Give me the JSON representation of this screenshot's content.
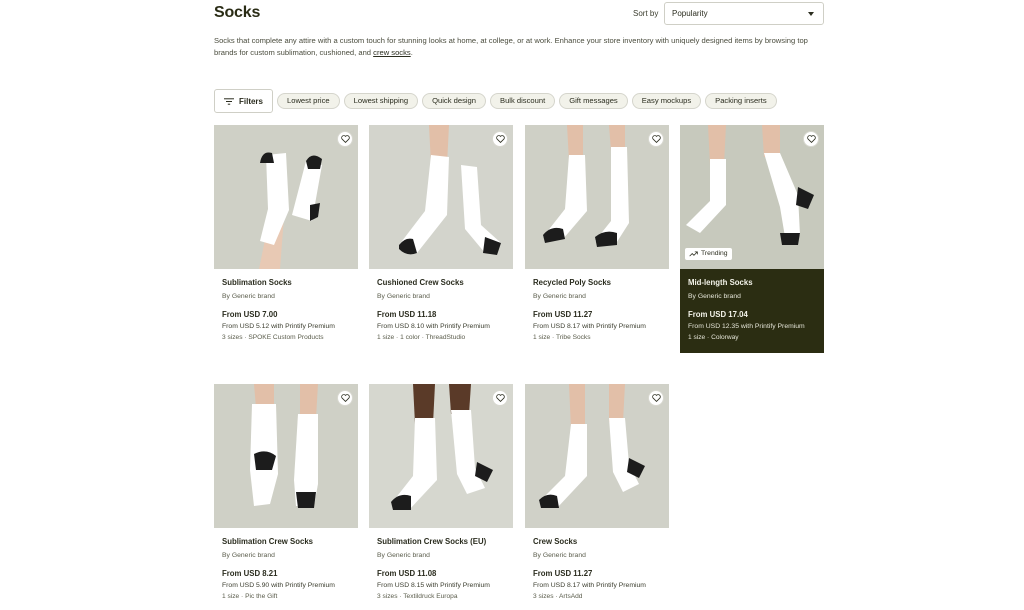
{
  "header": {
    "title": "Socks",
    "sort_label": "Sort by",
    "sort_value": "Popularity"
  },
  "description": {
    "text": "Socks that complete any attire with a custom touch for stunning looks at home, at college, or at work. Enhance your store inventory with uniquely designed items by browsing top brands for custom sublimation, cushioned, and ",
    "link": "crew socks",
    "end": "."
  },
  "filters": {
    "button_label": "Filters",
    "chips": [
      "Lowest price",
      "Lowest shipping",
      "Quick design",
      "Bulk discount",
      "Gift messages",
      "Easy mockups",
      "Packing inserts"
    ]
  },
  "products": [
    {
      "name": "Sublimation Socks",
      "brand": "By Generic brand",
      "price": "From USD 7.00",
      "premium": "From USD 5.12 with Printify Premium",
      "meta": "3 sizes · SPOKE Custom Products"
    },
    {
      "name": "Cushioned Crew Socks",
      "brand": "By Generic brand",
      "price": "From USD 11.18",
      "premium": "From USD 8.10 with Printify Premium",
      "meta": "1 size · 1 color · ThreadStudio"
    },
    {
      "name": "Recycled Poly Socks",
      "brand": "By Generic brand",
      "price": "From USD 11.27",
      "premium": "From USD 8.17 with Printify Premium",
      "meta": "1 size · Tribe Socks"
    },
    {
      "name": "Mid-length Socks",
      "brand": "By Generic brand",
      "price": "From USD 17.04",
      "premium": "From USD 12.35 with Printify Premium",
      "meta": "1 size · Colorway",
      "badge": "Trending"
    },
    {
      "name": "Sublimation Crew Socks",
      "brand": "By Generic brand",
      "price": "From USD 8.21",
      "premium": "From USD 5.90 with Printify Premium",
      "meta": "1 size · Pic the Gift"
    },
    {
      "name": "Sublimation Crew Socks (EU)",
      "brand": "By Generic brand",
      "price": "From USD 11.08",
      "premium": "From USD 8.15 with Printify Premium",
      "meta": "3 sizes · Textildruck Europa"
    },
    {
      "name": "Crew Socks",
      "brand": "By Generic brand",
      "price": "From USD 11.27",
      "premium": "From USD 8.17 with Printify Premium",
      "meta": "3 sizes · ArtsAdd"
    }
  ],
  "colors": {
    "accent_dark": "#2b2d12",
    "chip_bg": "#f2f2ea",
    "image_bg": "#c9cbbf"
  }
}
